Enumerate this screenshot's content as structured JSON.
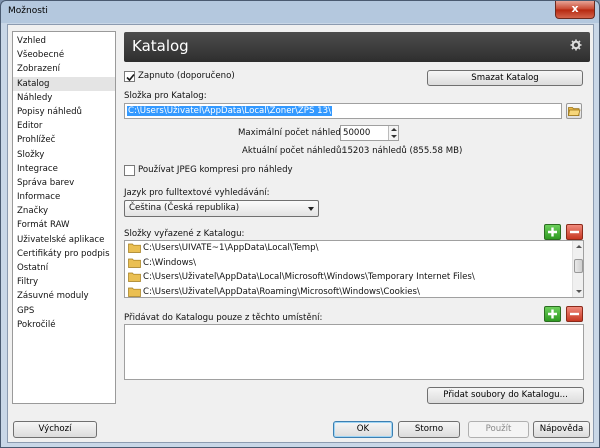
{
  "window": {
    "title": "Možnosti",
    "close_label": "x"
  },
  "sidebar": {
    "items": [
      {
        "label": "Vzhled",
        "selected": false
      },
      {
        "label": "Všeobecné",
        "selected": false
      },
      {
        "label": "Zobrazení",
        "selected": false
      },
      {
        "label": "Katalog",
        "selected": true
      },
      {
        "label": "Náhledy",
        "selected": false
      },
      {
        "label": "Popisy náhledů",
        "selected": false
      },
      {
        "label": "Editor",
        "selected": false
      },
      {
        "label": "Prohlížeč",
        "selected": false
      },
      {
        "label": "Složky",
        "selected": false
      },
      {
        "label": "Integrace",
        "selected": false
      },
      {
        "label": "Správa barev",
        "selected": false
      },
      {
        "label": "Informace",
        "selected": false
      },
      {
        "label": "Značky",
        "selected": false
      },
      {
        "label": "Formát RAW",
        "selected": false
      },
      {
        "label": "Uživatelské aplikace",
        "selected": false
      },
      {
        "label": "Certifikáty pro podpis",
        "selected": false
      },
      {
        "label": "Ostatní",
        "selected": false
      },
      {
        "label": "Filtry",
        "selected": false
      },
      {
        "label": "Zásuvné moduly",
        "selected": false
      },
      {
        "label": "GPS",
        "selected": false
      },
      {
        "label": "Pokročilé",
        "selected": false
      }
    ]
  },
  "header": {
    "title": "Katalog",
    "icon": "gear-icon"
  },
  "catalog": {
    "enabled_label": "Zapnuto (doporučeno)",
    "enabled_checked": true,
    "delete_button": "Smazat Katalog",
    "folder_label": "Složka pro Katalog:",
    "folder_value": "C:\\Users\\Uživatel\\AppData\\Local\\Zoner\\ZPS 13\\",
    "max_thumbs_label": "Maximální počet náhledů:",
    "max_thumbs_value": "50000",
    "current_thumbs_label": "Aktuální počet náhledů:",
    "current_thumbs_value": "15203 náhledů (855.58 MB)",
    "jpeg_label": "Používat JPEG kompresi pro náhledy",
    "jpeg_checked": false,
    "language_label": "Jazyk pro fulltextové vyhledávání:",
    "language_value": "Čeština (Česká republika)",
    "excluded_label": "Složky vyřazené z Katalogu:",
    "excluded_folders": [
      "C:\\Users\\UIVATE~1\\AppData\\Local\\Temp\\",
      "C:\\Windows\\",
      "C:\\Users\\Uživatel\\AppData\\Local\\Microsoft\\Windows\\Temporary Internet Files\\",
      "C:\\Users\\Uživatel\\AppData\\Roaming\\Microsoft\\Windows\\Cookies\\"
    ],
    "only_from_label": "Přidávat do Katalogu pouze z těchto umístění:",
    "add_files_button": "Přidat soubory do Katalogu..."
  },
  "footer": {
    "default_button": "Výchozí",
    "ok_button": "OK",
    "cancel_button": "Storno",
    "apply_button": "Použít",
    "help_button": "Nápověda"
  },
  "colors": {
    "banner": "#3a3a3a",
    "selection": "#3399ff",
    "add": "#3fa52f",
    "remove": "#d2412b"
  }
}
